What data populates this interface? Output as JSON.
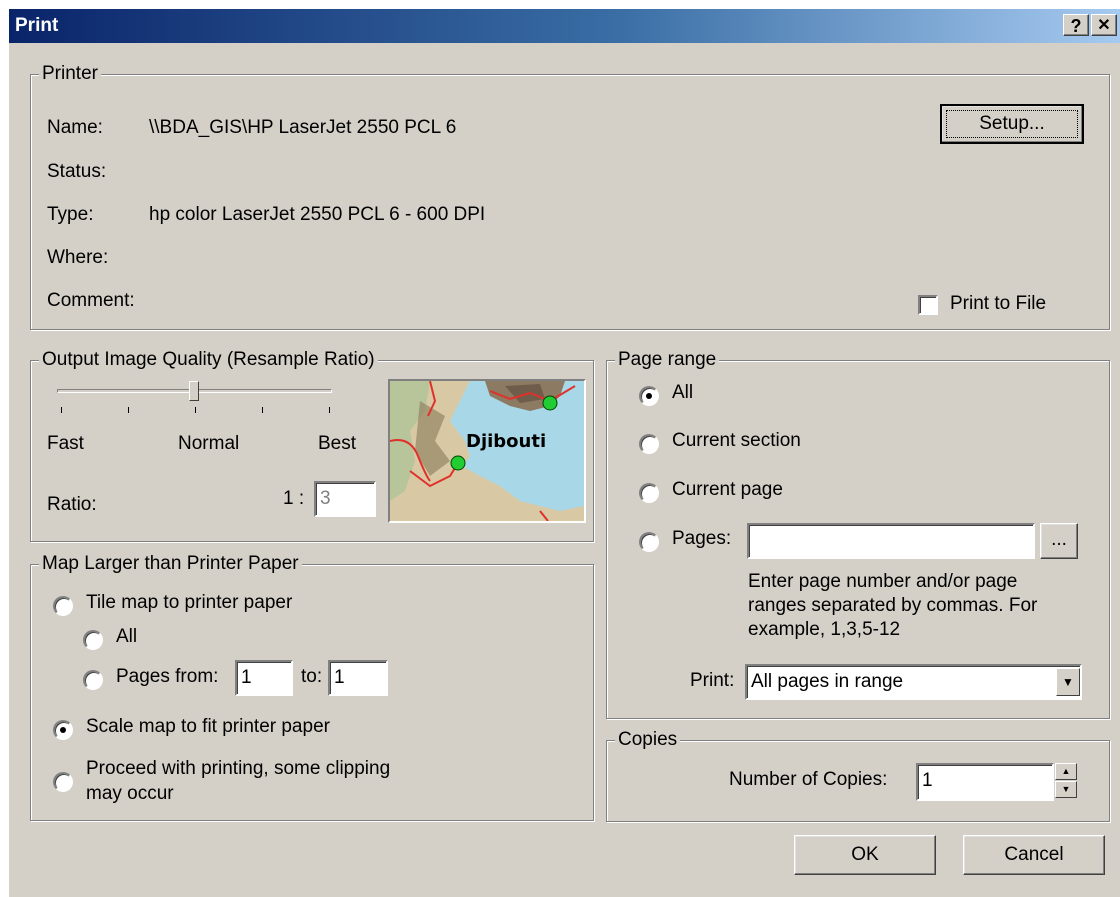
{
  "window": {
    "title": "Print",
    "help_label": "?",
    "close_label": "✕"
  },
  "printer": {
    "legend": "Printer",
    "name_label": "Name:",
    "name_value": "\\\\BDA_GIS\\HP LaserJet 2550 PCL 6",
    "status_label": "Status:",
    "status_value": "",
    "type_label": "Type:",
    "type_value": "hp color LaserJet 2550 PCL 6 - 600 DPI",
    "where_label": "Where:",
    "where_value": "",
    "comment_label": "Comment:",
    "comment_value": "",
    "setup_label": "Setup...",
    "print_to_file_label": "Print to File",
    "print_to_file_checked": false
  },
  "quality": {
    "legend": "Output Image Quality (Resample Ratio)",
    "fast_label": "Fast",
    "normal_label": "Normal",
    "best_label": "Best",
    "ratio_label": "Ratio:",
    "ratio_prefix": "1 :",
    "ratio_value": "3",
    "slider_position": 0.5,
    "map_label": "Djibouti"
  },
  "map_larger": {
    "legend": "Map Larger than Printer Paper",
    "tile_label": "Tile map to printer paper",
    "all_label": "All",
    "pages_from_label": "Pages from:",
    "pages_from_value": "1",
    "to_label": "to:",
    "to_value": "1",
    "scale_label": "Scale map to fit printer paper",
    "proceed_label_line1": "Proceed with printing, some clipping",
    "proceed_label_line2": "may occur",
    "selected": "scale"
  },
  "page_range": {
    "legend": "Page range",
    "all_label": "All",
    "current_section_label": "Current section",
    "current_page_label": "Current page",
    "pages_label": "Pages:",
    "pages_value": "",
    "browse_label": "...",
    "hint_line1": "Enter page number and/or page",
    "hint_line2": "ranges separated by commas.  For",
    "hint_line3": "example, 1,3,5-12",
    "print_label": "Print:",
    "print_value": "All pages in range",
    "selected": "all"
  },
  "copies": {
    "legend": "Copies",
    "number_label": "Number of Copies:",
    "number_value": "1"
  },
  "buttons": {
    "ok_label": "OK",
    "cancel_label": "Cancel"
  }
}
